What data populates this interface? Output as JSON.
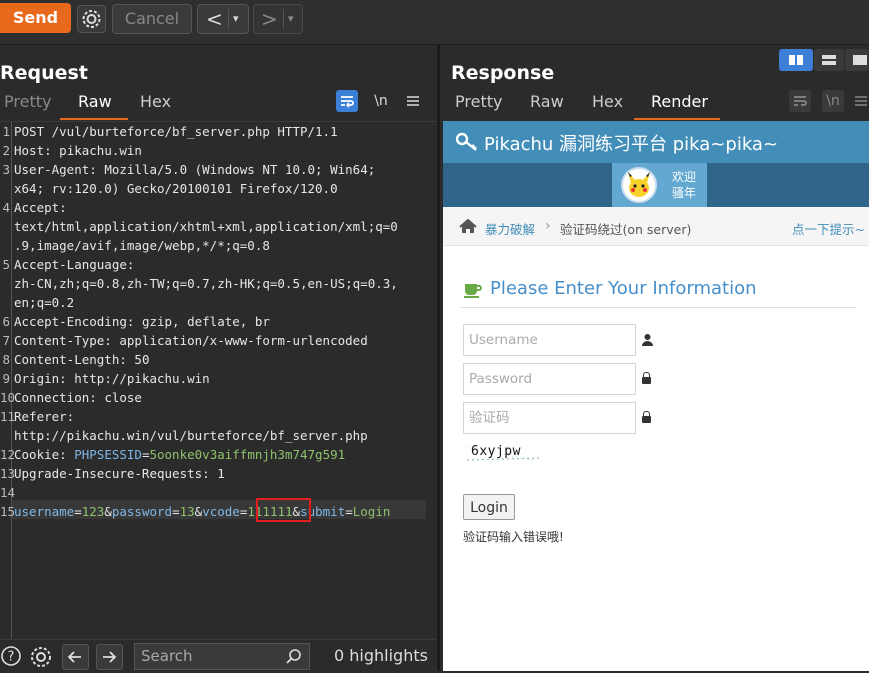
{
  "toolbar": {
    "send_label": "Send",
    "cancel_label": "Cancel",
    "prev_symbol": "<",
    "next_symbol": ">",
    "caret_symbol": "▾"
  },
  "request": {
    "title": "Request",
    "tabs": [
      "Pretty",
      "Raw",
      "Hex"
    ],
    "active_tab": "Raw",
    "newline_toggle": "\\n",
    "lines": [
      {
        "num": "1",
        "text": "POST /vul/burteforce/bf_server.php HTTP/1.1"
      },
      {
        "num": "2",
        "name": "Host:",
        "value": " pikachu.win"
      },
      {
        "num": "3",
        "name": "User-Agent:",
        "value": " Mozilla/5.0 (Windows NT 10.0; Win64;"
      },
      {
        "num": "",
        "text": "x64; rv:120.0) Gecko/20100101 Firefox/120.0"
      },
      {
        "num": "4",
        "name": "Accept:",
        "value": ""
      },
      {
        "num": "",
        "text": "text/html,application/xhtml+xml,application/xml;q=0"
      },
      {
        "num": "",
        "text": ".9,image/avif,image/webp,*/*;q=0.8"
      },
      {
        "num": "5",
        "name": "Accept-Language:",
        "value": ""
      },
      {
        "num": "",
        "text": "zh-CN,zh;q=0.8,zh-TW;q=0.7,zh-HK;q=0.5,en-US;q=0.3,"
      },
      {
        "num": "",
        "text": "en;q=0.2"
      },
      {
        "num": "6",
        "name": "Accept-Encoding:",
        "value": " gzip, deflate, br"
      },
      {
        "num": "7",
        "name": "Content-Type:",
        "value": " application/x-www-form-urlencoded"
      },
      {
        "num": "8",
        "name": "Content-Length:",
        "value": " 50"
      },
      {
        "num": "9",
        "name": "Origin:",
        "value": " http://pikachu.win"
      },
      {
        "num": "10",
        "name": "Connection:",
        "value": " close"
      },
      {
        "num": "11",
        "name": "Referer:",
        "value": ""
      },
      {
        "num": "",
        "text": "http://pikachu.win/vul/burteforce/bf_server.php"
      },
      {
        "num": "12",
        "name": "Cookie:",
        "value": ""
      },
      {
        "num": "13",
        "name": "Upgrade-Insecure-Requests:",
        "value": " 1"
      },
      {
        "num": "14",
        "text": ""
      },
      {
        "num": "15",
        "text": ""
      }
    ],
    "cookie": {
      "key": " PHPSESSID",
      "eq": "=",
      "value": "5oonke0v3aiffmnjh3m747g591"
    },
    "body": {
      "k1": "username",
      "v1": "123",
      "k2": "password",
      "v2": "13",
      "k3": "vcode",
      "v3": "111111",
      "k4": "submit",
      "v4": "Login",
      "amp": "&",
      "eq": "="
    },
    "search_placeholder": "Search",
    "highlights": "0 highlights"
  },
  "response": {
    "title": "Response",
    "tabs": [
      "Pretty",
      "Raw",
      "Hex",
      "Render"
    ],
    "active_tab": "Render",
    "newline_toggle": "\\n"
  },
  "render": {
    "site_title": "Pikachu 漏洞练习平台 pika~pika~",
    "welcome_line1": "欢迎",
    "welcome_line2": "骚年",
    "breadcrumb_1": "暴力破解",
    "breadcrumb_sep": "›",
    "breadcrumb_2": "验证码绕过(on server)",
    "hint_link": "点一下提示~",
    "form_heading": "Please Enter Your Information",
    "username_placeholder": "Username",
    "password_placeholder": "Password",
    "vcode_placeholder": "验证码",
    "captcha_text": "6xyjpw",
    "login_button": "Login",
    "error_message": "验证码输入错误哦!"
  },
  "colors": {
    "send": "#e8691c",
    "accent_tab": "#e8691c",
    "pikachu_header": "#438eb9",
    "vcode_highlight": "#e01e1e",
    "green_value": "#8ec26a",
    "blue_key": "#7fb7e6"
  }
}
